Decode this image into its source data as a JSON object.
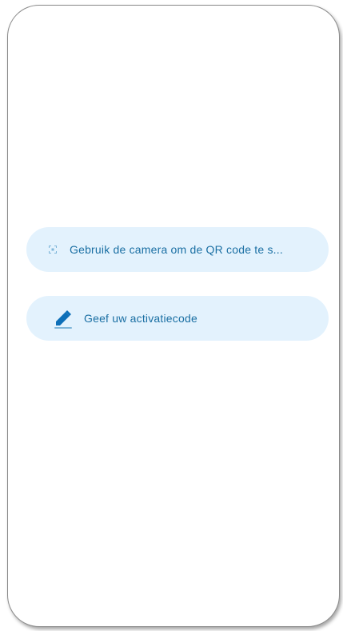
{
  "actions": {
    "scan_qr": {
      "label": "Gebruik de camera om de QR code te s...",
      "icon": "qr-scan-icon"
    },
    "enter_code": {
      "label": "Geef uw activatiecode",
      "icon": "pencil-icon"
    }
  },
  "colors": {
    "button_background": "#e3f2fd",
    "text": "#1a6fa3",
    "icon_primary": "#0d6fb8"
  }
}
